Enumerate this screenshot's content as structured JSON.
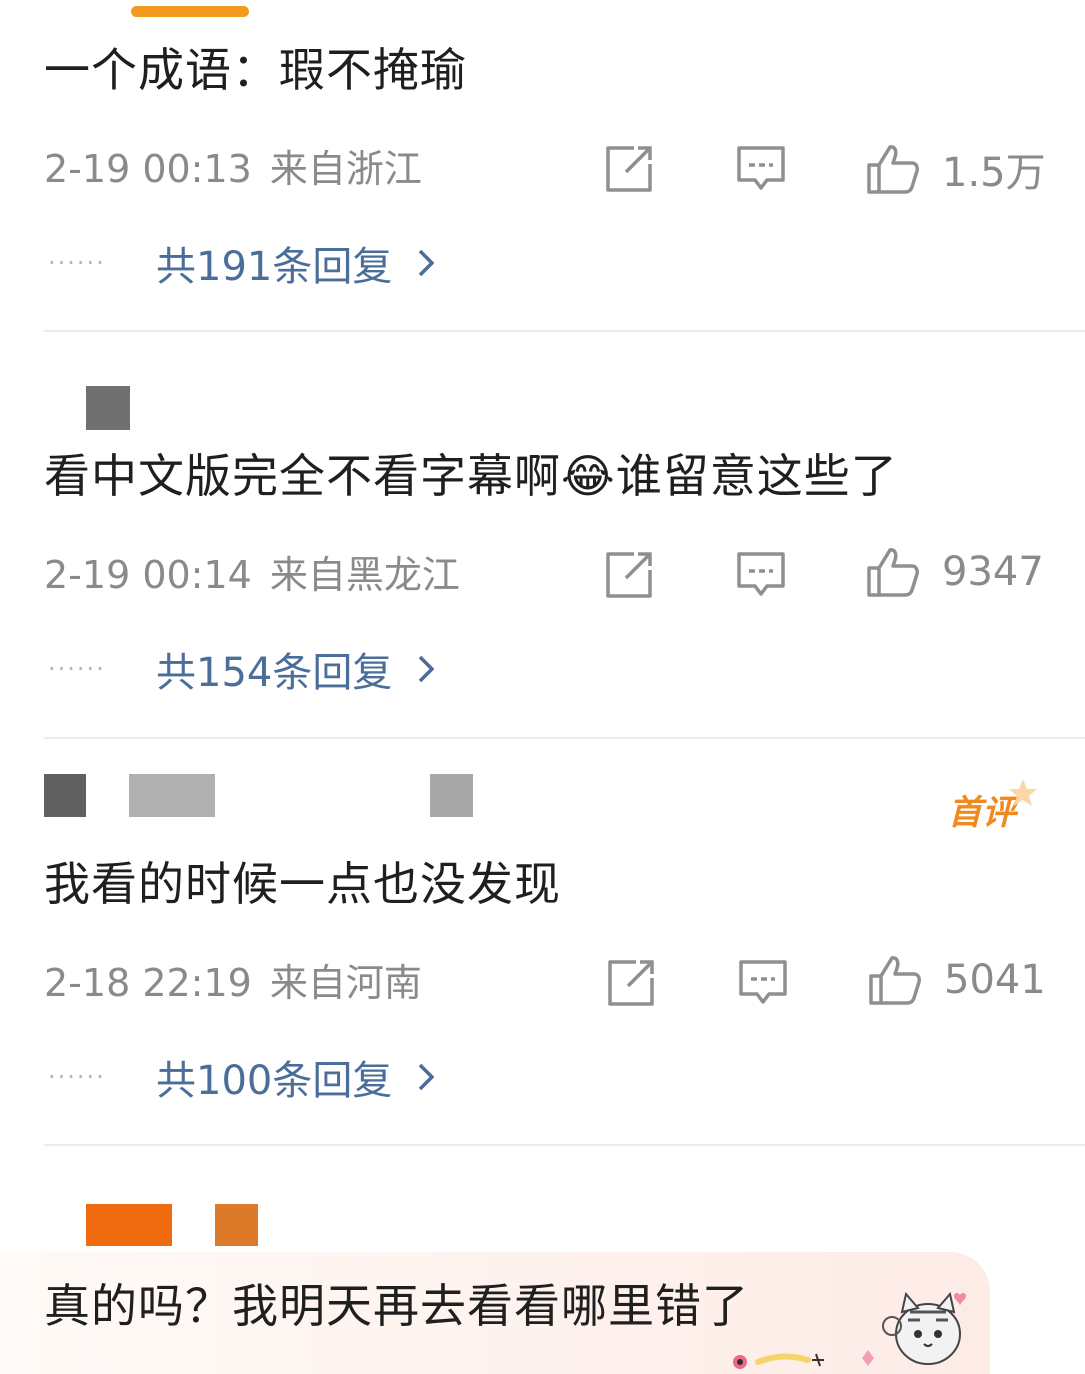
{
  "comments": [
    {
      "text": "一个成语：瑕不掩瑜",
      "time": "2-19 00:13",
      "location": "来自浙江",
      "likes": "1.5万",
      "replies": "共191条回复"
    },
    {
      "text_before": "看中文版完全不看字幕啊",
      "emoji": "😂",
      "text_after": "谁留意这些了",
      "time": "2-19 00:14",
      "location": "来自黑龙江",
      "likes": "9347",
      "replies": "共154条回复"
    },
    {
      "text": "我看的时候一点也没发现",
      "badge": "首评",
      "time": "2-18 22:19",
      "location": "来自河南",
      "likes": "5041",
      "replies": "共100条回复"
    },
    {
      "text": "真的吗？我明天再去看看哪里错了"
    }
  ],
  "icons": {
    "share": "share-icon",
    "comment": "comment-icon",
    "like": "thumbs-up-icon",
    "chevron": "chevron-right-icon"
  },
  "colors": {
    "accent": "#f29a1f",
    "reply_link": "#4a6d9a",
    "meta": "#8a8a8a",
    "badge": "#f18a1e"
  }
}
